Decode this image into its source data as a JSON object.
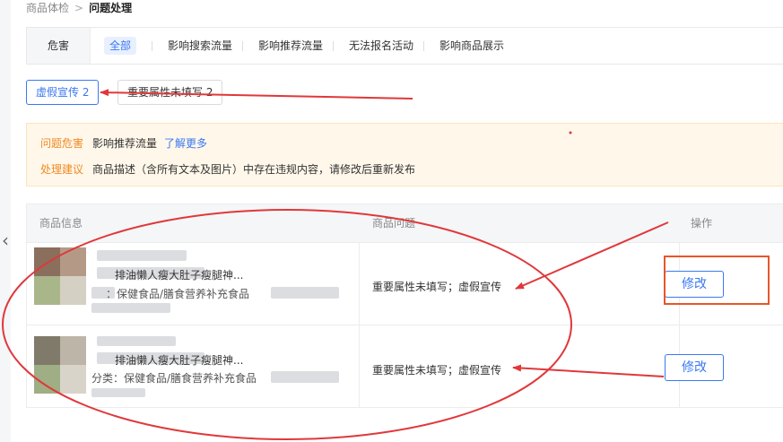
{
  "breadcrumb": {
    "parent": "商品体检",
    "separator": ">",
    "current": "问题处理"
  },
  "filter": {
    "label": "危害",
    "chips": [
      "全部",
      "影响搜索流量",
      "影响推荐流量",
      "无法报名活动",
      "影响商品展示"
    ],
    "active_index": 0
  },
  "issue_tabs": [
    {
      "label": "虚假宣传 2",
      "active": true
    },
    {
      "label": "重要属性未填写 2",
      "active": false
    }
  ],
  "notice": {
    "harm_key": "问题危害",
    "harm_value": "影响推荐流量",
    "learn_more": "了解更多",
    "advice_key": "处理建议",
    "advice_value": "商品描述（含所有文本及图片）中存在违规内容，请修改后重新发布"
  },
  "table": {
    "headers": {
      "product": "商品信息",
      "problem": "商品问题",
      "action": "操作"
    },
    "rows": [
      {
        "title": "排油懒人瘦大肚子瘦腿神...",
        "category": "：保健食品/膳食营养补充食品",
        "problem": "重要属性未填写；虚假宣传",
        "action": "修改"
      },
      {
        "title": "排油懒人瘦大肚子瘦腿神...",
        "category": "分类：保健食品/膳食营养补充食品",
        "problem": "重要属性未填写；虚假宣传",
        "action": "修改"
      }
    ]
  },
  "icons": {
    "back": "chevron-left-icon"
  },
  "colors": {
    "accent": "#3a78f2",
    "warning": "#f08a24",
    "notice_bg": "#fff7ea",
    "annotation": "#e0383a",
    "highlight": "#e8562a"
  }
}
